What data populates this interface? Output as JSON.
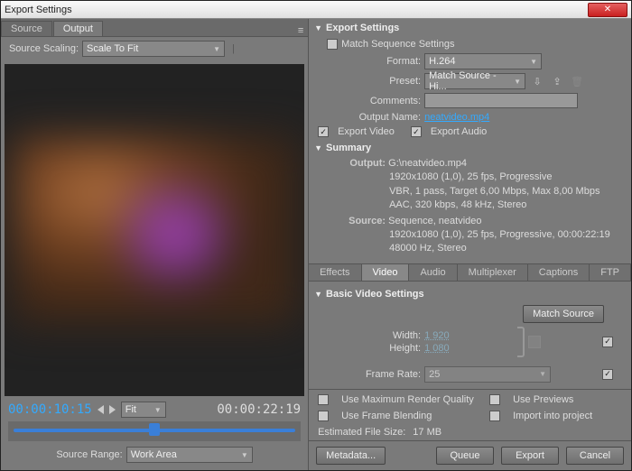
{
  "window": {
    "title": "Export Settings"
  },
  "left": {
    "tabs": {
      "source": "Source",
      "output": "Output"
    },
    "source_scaling_label": "Source Scaling:",
    "source_scaling_value": "Scale To Fit",
    "timecode_in": "00:00:10:15",
    "timecode_out": "00:00:22:19",
    "fit_label": "Fit",
    "source_range_label": "Source Range:",
    "source_range_value": "Work Area"
  },
  "export": {
    "header": "Export Settings",
    "match_sequence": "Match Sequence Settings",
    "format_label": "Format:",
    "format_value": "H.264",
    "preset_label": "Preset:",
    "preset_value": "Match Source - Hi...",
    "comments_label": "Comments:",
    "comments_value": "",
    "output_name_label": "Output Name:",
    "output_name_value": "neatvideo.mp4",
    "export_video": "Export Video",
    "export_audio": "Export Audio"
  },
  "summary": {
    "header": "Summary",
    "output_label": "Output:",
    "output_line1": "G:\\neatvideo.mp4",
    "output_line2": "1920x1080 (1,0), 25 fps, Progressive",
    "output_line3": "VBR, 1 pass, Target 6,00 Mbps, Max 8,00 Mbps",
    "output_line4": "AAC, 320 kbps, 48 kHz, Stereo",
    "source_label": "Source:",
    "source_line1": "Sequence, neatvideo",
    "source_line2": "1920x1080 (1,0), 25 fps, Progressive, 00:00:22:19",
    "source_line3": "48000 Hz, Stereo"
  },
  "detail_tabs": {
    "effects": "Effects",
    "video": "Video",
    "audio": "Audio",
    "multiplexer": "Multiplexer",
    "captions": "Captions",
    "ftp": "FTP"
  },
  "video": {
    "header": "Basic Video Settings",
    "match_source_btn": "Match Source",
    "width_label": "Width:",
    "width_value": "1 920",
    "height_label": "Height:",
    "height_value": "1 080",
    "frame_rate_label": "Frame Rate:",
    "frame_rate_value": "25"
  },
  "bottom": {
    "max_quality": "Use Maximum Render Quality",
    "use_previews": "Use Previews",
    "frame_blending": "Use Frame Blending",
    "import_project": "Import into project",
    "est_label": "Estimated File Size:",
    "est_value": "17 MB",
    "metadata_btn": "Metadata...",
    "queue_btn": "Queue",
    "export_btn": "Export",
    "cancel_btn": "Cancel"
  }
}
